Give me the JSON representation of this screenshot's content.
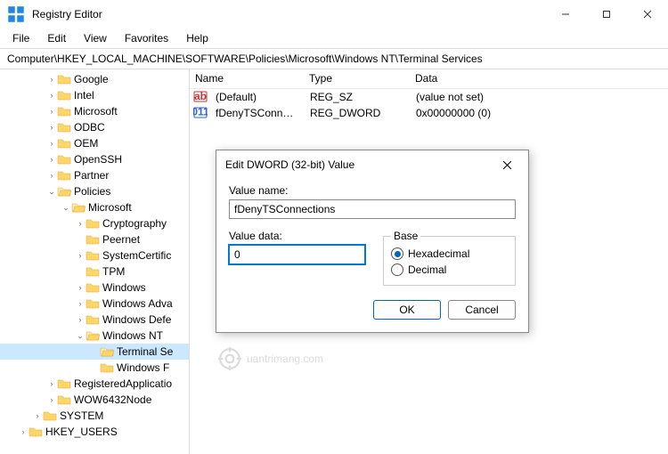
{
  "window": {
    "title": "Registry Editor",
    "controls": {
      "minimize": "minimize",
      "maximize": "maximize",
      "close": "close"
    }
  },
  "menu": {
    "file": "File",
    "edit": "Edit",
    "view": "View",
    "favorites": "Favorites",
    "help": "Help"
  },
  "address": {
    "label": "Computer",
    "path": "\\HKEY_LOCAL_MACHINE\\SOFTWARE\\Policies\\Microsoft\\Windows NT\\Terminal Services"
  },
  "tree": [
    {
      "indent": 3,
      "exp": ">",
      "label": "Google",
      "open": false
    },
    {
      "indent": 3,
      "exp": ">",
      "label": "Intel",
      "open": false
    },
    {
      "indent": 3,
      "exp": ">",
      "label": "Microsoft",
      "open": false
    },
    {
      "indent": 3,
      "exp": ">",
      "label": "ODBC",
      "open": false
    },
    {
      "indent": 3,
      "exp": ">",
      "label": "OEM",
      "open": false
    },
    {
      "indent": 3,
      "exp": ">",
      "label": "OpenSSH",
      "open": false
    },
    {
      "indent": 3,
      "exp": ">",
      "label": "Partner",
      "open": false
    },
    {
      "indent": 3,
      "exp": "v",
      "label": "Policies",
      "open": true
    },
    {
      "indent": 4,
      "exp": "v",
      "label": "Microsoft",
      "open": true
    },
    {
      "indent": 5,
      "exp": ">",
      "label": "Cryptography",
      "open": false
    },
    {
      "indent": 5,
      "exp": "",
      "label": "Peernet",
      "open": false
    },
    {
      "indent": 5,
      "exp": ">",
      "label": "SystemCertific",
      "open": false
    },
    {
      "indent": 5,
      "exp": "",
      "label": "TPM",
      "open": false
    },
    {
      "indent": 5,
      "exp": ">",
      "label": "Windows",
      "open": false
    },
    {
      "indent": 5,
      "exp": ">",
      "label": "Windows Adva",
      "open": false
    },
    {
      "indent": 5,
      "exp": ">",
      "label": "Windows Defe",
      "open": false
    },
    {
      "indent": 5,
      "exp": "v",
      "label": "Windows NT",
      "open": true
    },
    {
      "indent": 6,
      "exp": "",
      "label": "Terminal Se",
      "open": true,
      "selected": true
    },
    {
      "indent": 6,
      "exp": "",
      "label": "Windows F",
      "open": false
    },
    {
      "indent": 3,
      "exp": ">",
      "label": "RegisteredApplicatio",
      "open": false
    },
    {
      "indent": 3,
      "exp": ">",
      "label": "WOW6432Node",
      "open": false
    },
    {
      "indent": 2,
      "exp": ">",
      "label": "SYSTEM",
      "open": false
    },
    {
      "indent": 1,
      "exp": ">",
      "label": "HKEY_USERS",
      "open": false
    }
  ],
  "list": {
    "cols": {
      "name": "Name",
      "type": "Type",
      "data": "Data"
    },
    "rows": [
      {
        "icon": "sz",
        "name": "(Default)",
        "type": "REG_SZ",
        "data": "(value not set)"
      },
      {
        "icon": "dword",
        "name": "fDenyTSConnec...",
        "type": "REG_DWORD",
        "data": "0x00000000 (0)"
      }
    ]
  },
  "dialog": {
    "title": "Edit DWORD (32-bit) Value",
    "value_name_label": "Value name:",
    "value_name": "fDenyTSConnections",
    "value_data_label": "Value data:",
    "value_data": "0",
    "base_label": "Base",
    "hex_label": "Hexadecimal",
    "dec_label": "Decimal",
    "base_selected": "hex",
    "ok": "OK",
    "cancel": "Cancel"
  },
  "watermark": "uantrimang.com"
}
